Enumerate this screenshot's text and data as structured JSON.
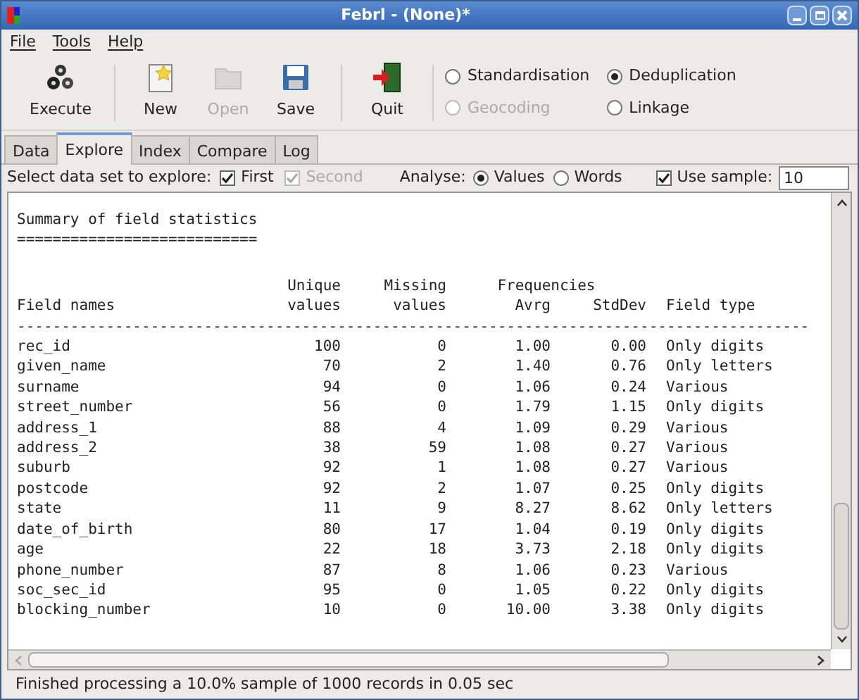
{
  "window": {
    "title": "Febrl - (None)*"
  },
  "menu": [
    {
      "label": "File"
    },
    {
      "label": "Tools"
    },
    {
      "label": "Help"
    }
  ],
  "toolbar": [
    {
      "kind": "execute",
      "label": "Execute",
      "disabled": false
    },
    {
      "kind": "new",
      "label": "New",
      "disabled": false
    },
    {
      "kind": "open",
      "label": "Open",
      "disabled": true
    },
    {
      "kind": "save",
      "label": "Save",
      "disabled": false
    },
    {
      "kind": "quit",
      "label": "Quit",
      "disabled": false
    }
  ],
  "modes": [
    {
      "label": "Standardisation",
      "selected": false,
      "disabled": false
    },
    {
      "label": "Deduplication",
      "selected": true,
      "disabled": false
    },
    {
      "label": "Geocoding",
      "selected": false,
      "disabled": true
    },
    {
      "label": "Linkage",
      "selected": false,
      "disabled": false
    }
  ],
  "tabs": [
    {
      "label": "Data",
      "selected": false
    },
    {
      "label": "Explore",
      "selected": true
    },
    {
      "label": "Index",
      "selected": false
    },
    {
      "label": "Compare",
      "selected": false
    },
    {
      "label": "Log",
      "selected": false
    }
  ],
  "options": {
    "dataset_label": "Select data set to explore:",
    "datasets": [
      {
        "label": "First",
        "checked": true,
        "disabled": false
      },
      {
        "label": "Second",
        "checked": true,
        "disabled": true
      }
    ],
    "analyse_label": "Analyse:",
    "analyse": [
      {
        "label": "Values",
        "selected": true
      },
      {
        "label": "Words",
        "selected": false
      }
    ],
    "use_sample": {
      "label": "Use sample:",
      "checked": true,
      "value": "10"
    }
  },
  "report": {
    "title": "Summary of field statistics",
    "underline": "===========================",
    "header_top": [
      "Unique",
      "Missing",
      "Frequencies"
    ],
    "header_bottom": [
      "Field names",
      "values",
      "values",
      "Avrg",
      "StdDev",
      "Field type"
    ],
    "separator": "-----------------------------------------------------------------------------------------",
    "rows": [
      [
        "rec_id",
        "100",
        "0",
        "1.00",
        "0.00",
        "Only digits"
      ],
      [
        "given_name",
        "70",
        "2",
        "1.40",
        "0.76",
        "Only letters"
      ],
      [
        "surname",
        "94",
        "0",
        "1.06",
        "0.24",
        "Various"
      ],
      [
        "street_number",
        "56",
        "0",
        "1.79",
        "1.15",
        "Only digits"
      ],
      [
        "address_1",
        "88",
        "4",
        "1.09",
        "0.29",
        "Various"
      ],
      [
        "address_2",
        "38",
        "59",
        "1.08",
        "0.27",
        "Various"
      ],
      [
        "suburb",
        "92",
        "1",
        "1.08",
        "0.27",
        "Various"
      ],
      [
        "postcode",
        "92",
        "2",
        "1.07",
        "0.25",
        "Only digits"
      ],
      [
        "state",
        "11",
        "9",
        "8.27",
        "8.62",
        "Only letters"
      ],
      [
        "date_of_birth",
        "80",
        "17",
        "1.04",
        "0.19",
        "Only digits"
      ],
      [
        "age",
        "22",
        "18",
        "3.73",
        "2.18",
        "Only digits"
      ],
      [
        "phone_number",
        "87",
        "8",
        "1.06",
        "0.23",
        "Various"
      ],
      [
        "soc_sec_id",
        "95",
        "0",
        "1.05",
        "0.22",
        "Only digits"
      ],
      [
        "blocking_number",
        "10",
        "0",
        "10.00",
        "3.38",
        "Only digits"
      ]
    ]
  },
  "status_bar": "Finished processing a 10.0% sample of 1000 records in 0.05 sec"
}
